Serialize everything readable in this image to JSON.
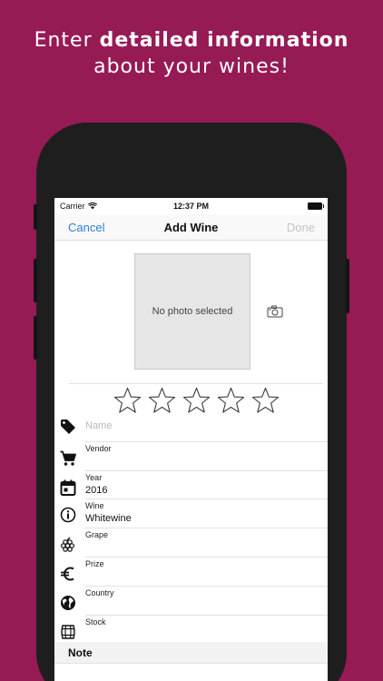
{
  "headline": {
    "line1_prefix": "Enter ",
    "line1_bold": "detailed information",
    "line2": "about your wines!"
  },
  "status_bar": {
    "carrier": "Carrier",
    "time": "12:37 PM"
  },
  "nav": {
    "cancel": "Cancel",
    "title": "Add Wine",
    "done": "Done"
  },
  "photo": {
    "placeholder": "No photo selected"
  },
  "rating": {
    "value": 0,
    "max": 5
  },
  "fields": {
    "name": {
      "placeholder": "Name",
      "icon": "tag-icon"
    },
    "vendor": {
      "label": "Vendor",
      "value": "",
      "icon": "cart-icon"
    },
    "year": {
      "label": "Year",
      "value": "2016",
      "icon": "calendar-icon"
    },
    "wine": {
      "label": "Wine",
      "value": "Whitewine",
      "icon": "info-icon"
    },
    "grape": {
      "label": "Grape",
      "value": "",
      "icon": "grape-icon"
    },
    "prize": {
      "label": "Prize",
      "value": "",
      "icon": "euro-icon"
    },
    "country": {
      "label": "Country",
      "value": "",
      "icon": "globe-icon"
    },
    "stock": {
      "label": "Stock",
      "value": "",
      "icon": "barrel-icon"
    }
  },
  "note": {
    "label": "Note"
  },
  "colors": {
    "background": "#961a54",
    "accent": "#2f7dd6",
    "disabled": "#c4c4c4"
  }
}
